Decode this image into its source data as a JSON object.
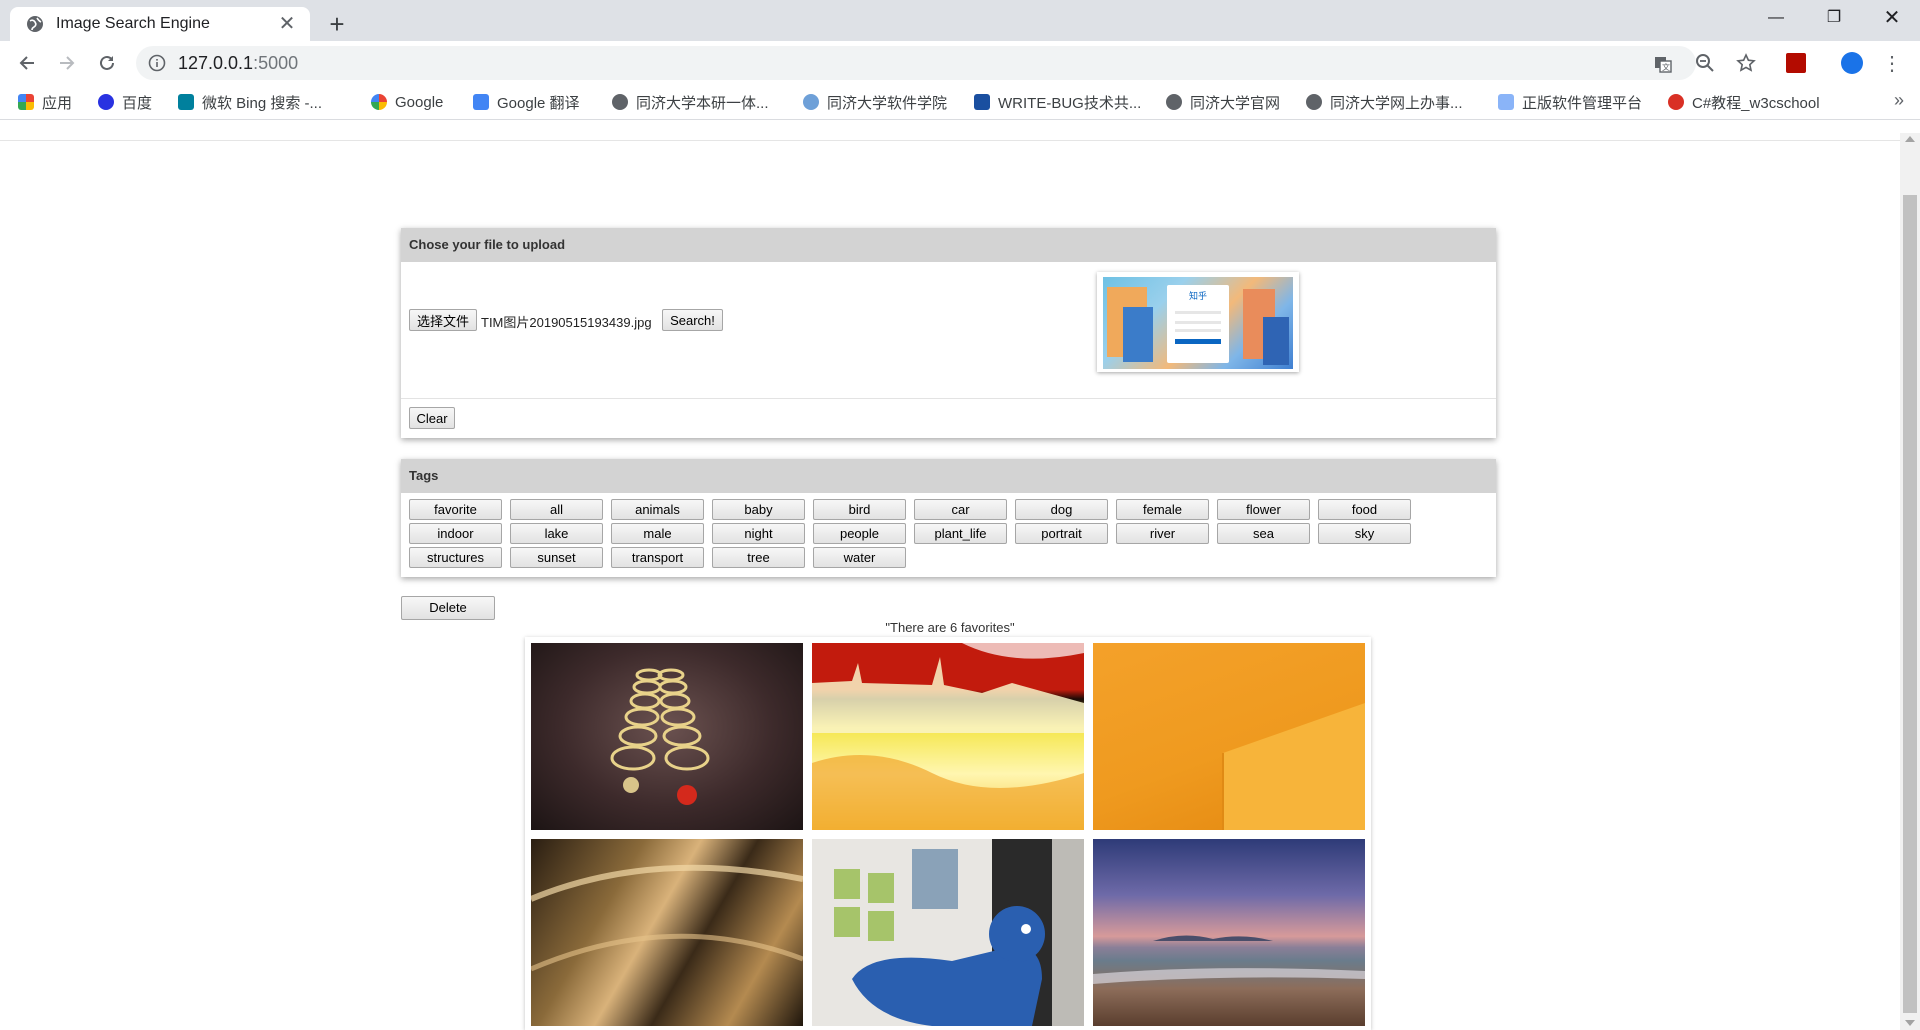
{
  "browser": {
    "tab_title": "Image Search Engine",
    "url_host": "127.0.0.1",
    "url_port": ":5000",
    "bookmarks": [
      {
        "label": "应用",
        "color": "#4285f4"
      },
      {
        "label": "百度",
        "color": "#2932e1"
      },
      {
        "label": "微软 Bing 搜索 -...",
        "color": "#00809d"
      },
      {
        "label": "Google",
        "color": "#ea4335"
      },
      {
        "label": "Google 翻译",
        "color": "#4285f4"
      },
      {
        "label": "同济大学本研一体...",
        "color": "#5f6368"
      },
      {
        "label": "同济大学软件学院",
        "color": "#6ea0d8"
      },
      {
        "label": "WRITE-BUG技术共...",
        "color": "#1a4fa0"
      },
      {
        "label": "同济大学官网",
        "color": "#5f6368"
      },
      {
        "label": "同济大学网上办事...",
        "color": "#5f6368"
      },
      {
        "label": "正版软件管理平台",
        "color": "#8ab4f8"
      },
      {
        "label": "C#教程_w3cschool",
        "color": "#d93025"
      }
    ],
    "more_label": "»"
  },
  "upload": {
    "header": "Chose your file to upload",
    "choose_label": "选择文件",
    "filename": "TIM图片20190515193439.jpg",
    "search_label": "Search!",
    "clear_label": "Clear",
    "preview_text": "知乎"
  },
  "tags": {
    "header": "Tags",
    "rows": [
      [
        "favorite",
        "all",
        "animals",
        "baby",
        "bird",
        "car",
        "dog",
        "female",
        "flower",
        "food"
      ],
      [
        "indoor",
        "lake",
        "male",
        "night",
        "people",
        "plant_life",
        "portrait",
        "river",
        "sea",
        "sky"
      ],
      [
        "structures",
        "sunset",
        "transport",
        "tree",
        "water"
      ]
    ]
  },
  "favorites": {
    "delete_label": "Delete",
    "caption": "\"There are 6 favorites\"",
    "images": [
      {
        "name": "lighted-circles-floor"
      },
      {
        "name": "red-yellow-castle-silhouette"
      },
      {
        "name": "orange-wall-corner"
      },
      {
        "name": "golden-abstract-curves"
      },
      {
        "name": "blue-graffiti-character"
      },
      {
        "name": "beach-at-dusk"
      }
    ]
  }
}
